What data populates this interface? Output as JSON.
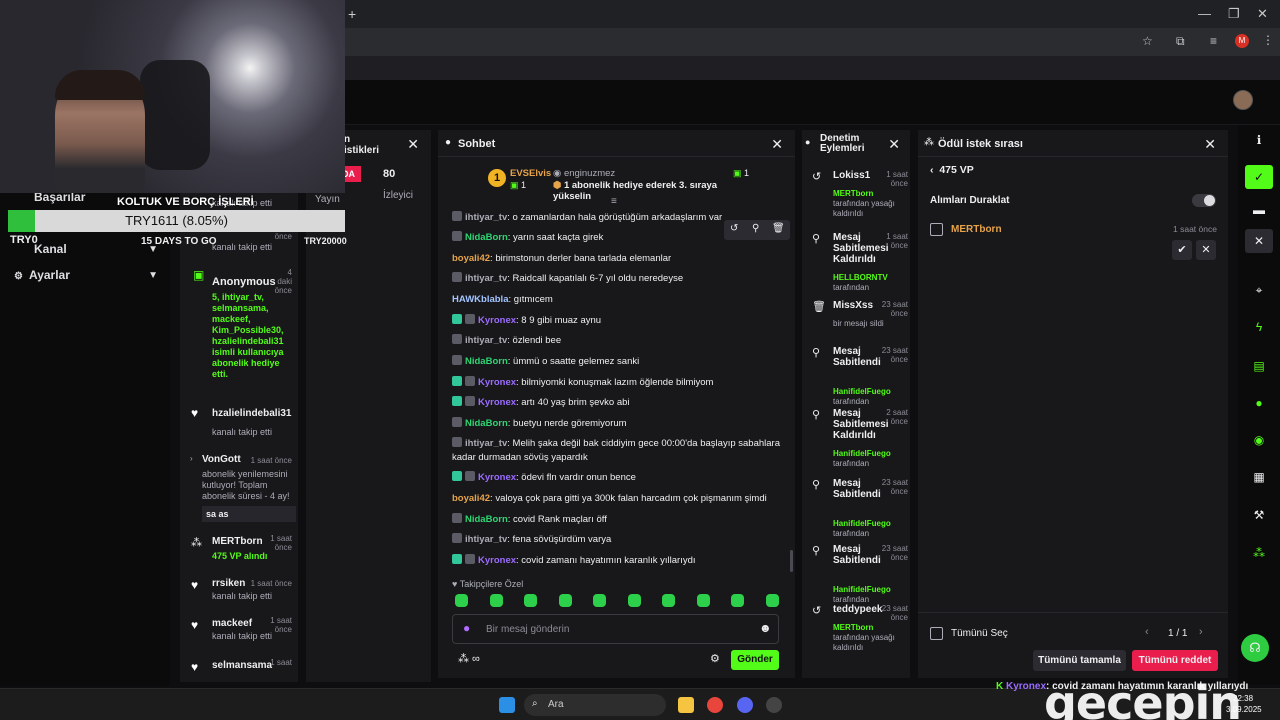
{
  "overlay": {
    "goal_title": "KOLTUK VE BORÇ İŞLERİ",
    "progress_text": "TRY1611 (8.05%)",
    "progress_fraction": 0.0805,
    "min_label": "TRY0",
    "days_left": "15 DAYS TO GO"
  },
  "left_nav": {
    "items": [
      {
        "label": "Başarılar"
      },
      {
        "label": "Kanal"
      },
      {
        "label": "Ayarlar"
      }
    ]
  },
  "activity_feed": [
    {
      "name": "",
      "sub": "kanalı takip etti",
      "time": ""
    },
    {
      "name": "",
      "sub": "kanalı takip etti",
      "time": "önce"
    },
    {
      "name": "Anonymous",
      "sub": "5, ihtiyar_tv, selmansama, mackeef, Kim_Possible30, hzalielindebali31 isimli kullanıcıya abonelik hediye etti.",
      "time": "4 daki önce"
    },
    {
      "name": "hzalielindebali31",
      "sub": "kanalı takip etti",
      "time": ""
    },
    {
      "name": "VonGott",
      "sub": "abonelik yenilemesini kutluyor! Toplam abonelik süresi - 4 ay!",
      "time": "1 saat önce",
      "message": "sa as"
    },
    {
      "name": "MERTborn",
      "sub": "475 VP alındı",
      "time": "1 saat önce"
    },
    {
      "name": "rrsiken",
      "sub": "kanalı takip etti",
      "time": "1 saat önce"
    },
    {
      "name": "mackeef",
      "sub": "kanalı takip etti",
      "time": "1 saat önce"
    },
    {
      "name": "selmansama",
      "sub": "",
      "time": "1 saat"
    }
  ],
  "stats": {
    "title_line1": "n",
    "title_line2": "istikleri",
    "tag": "DA",
    "viewers_value": "80",
    "viewers_label": "İzleyici",
    "stream_label": "Yayın",
    "goal_value": "TRY20000"
  },
  "chat": {
    "title": "Sohbet",
    "pinned": {
      "user": "EVSElvis",
      "level": "1",
      "gifter": "enginuzmez",
      "gifter_count": "1",
      "text": "1 abonelik hediye ederek 3. sıraya yükselin"
    },
    "messages": [
      {
        "user": "ihtiyar_tv",
        "color": "gray",
        "badges": [
          "mod"
        ],
        "text": "o zamanlardan hala görüştüğüm arkadaşlarım var"
      },
      {
        "user": "NidaBorn",
        "color": "green",
        "badges": [
          "mod"
        ],
        "text": "yarın saat kaçta girek"
      },
      {
        "user": "boyali42",
        "color": "orange",
        "badges": [],
        "text": "birimstonun derler bana tarlada elemanlar"
      },
      {
        "user": "ihtiyar_tv",
        "color": "gray",
        "badges": [
          "mod"
        ],
        "text": "Raidcall kapatılalı 6-7 yıl oldu neredeyse"
      },
      {
        "user": "HAWKblabla",
        "color": "blue",
        "badges": [],
        "text": "gıtmıcem"
      },
      {
        "user": "Kyronex",
        "color": "purple",
        "badges": [
          "sub",
          "mod"
        ],
        "text": "8 9 gibi muaz aynu"
      },
      {
        "user": "ihtiyar_tv",
        "color": "gray",
        "badges": [
          "mod"
        ],
        "text": "özlendi bee"
      },
      {
        "user": "NidaBorn",
        "color": "green",
        "badges": [
          "mod"
        ],
        "text": "ümmü o saatte gelemez sanki"
      },
      {
        "user": "Kyronex",
        "color": "purple",
        "badges": [
          "sub",
          "mod"
        ],
        "text": "bilmiyomki konuşmak lazım öğlende bilmiyom"
      },
      {
        "user": "Kyronex",
        "color": "purple",
        "badges": [
          "sub",
          "mod"
        ],
        "text": "artı 40 yaş brim şevko abi"
      },
      {
        "user": "NidaBorn",
        "color": "green",
        "badges": [
          "mod"
        ],
        "text": "buetyu nerde göremiyorum"
      },
      {
        "user": "ihtiyar_tv",
        "color": "gray",
        "badges": [
          "mod"
        ],
        "text": "Melih şaka değil bak ciddiyim gece 00:00'da başlayıp sabahlara kadar durmadan sövüş yapardık"
      },
      {
        "user": "Kyronex",
        "color": "purple",
        "badges": [
          "sub",
          "mod"
        ],
        "text": "ödevi fln vardır onun bence"
      },
      {
        "user": "boyali42",
        "color": "orange",
        "badges": [],
        "text": "valoya çok para gitti ya 300k falan harcadım çok pişmanım şimdi"
      },
      {
        "user": "NidaBorn",
        "color": "green",
        "badges": [
          "mod"
        ],
        "text": "covid Rank maçları öff"
      },
      {
        "user": "ihtiyar_tv",
        "color": "gray",
        "badges": [
          "mod"
        ],
        "text": "fena sövüşürdüm varya"
      },
      {
        "user": "Kyronex",
        "color": "purple",
        "badges": [
          "sub",
          "mod"
        ],
        "text": "covid zamanı hayatımın karanlık yıllarıydı"
      }
    ],
    "followers_only": "Takipçilere Özel",
    "input_placeholder": "Bir mesaj gönderin",
    "send_label": "Gönder"
  },
  "moderation": {
    "title_line1": "Denetim",
    "title_line2": "Eylemleri",
    "items": [
      {
        "icon": "undo-icon",
        "title": "Lokiss1",
        "time": "1 saat önce",
        "actor": "MERTborn",
        "desc": "tarafından yasağı kaldırıldı"
      },
      {
        "icon": "unpin-icon",
        "title": "Mesaj Sabitlemesi Kaldırıldı",
        "time": "1 saat önce",
        "actor": "HELLBORNTV",
        "desc": "tarafından"
      },
      {
        "icon": "trash-icon",
        "title": "MissXss",
        "time": "23 saat önce",
        "actor": "",
        "desc": "bir mesajı sildi"
      },
      {
        "icon": "pin-icon",
        "title": "Mesaj Sabitlendi",
        "time": "23 saat önce",
        "actor": "HanifidelFuego",
        "desc": "tarafından"
      },
      {
        "icon": "unpin-icon",
        "title": "Mesaj Sabitlemesi Kaldırıldı",
        "time": "2 saat önce",
        "actor": "HanifidelFuego",
        "desc": "tarafından"
      },
      {
        "icon": "pin-icon",
        "title": "Mesaj Sabitlendi",
        "time": "23 saat önce",
        "actor": "HanifidelFuego",
        "desc": "tarafından"
      },
      {
        "icon": "pin-icon",
        "title": "Mesaj Sabitlendi",
        "time": "23 saat önce",
        "actor": "HanifidelFuego",
        "desc": "tarafından"
      },
      {
        "icon": "undo-icon",
        "title": "teddypeek",
        "time": "23 saat önce",
        "actor": "MERTborn",
        "desc": "tarafından yasağı kaldırıldı"
      }
    ]
  },
  "rewards": {
    "title": "Ödül istek sırası",
    "back_label": "475 VP",
    "pause_label": "Alımları Duraklat",
    "request_user": "MERTborn",
    "request_time": "1 saat önce",
    "select_all": "Tümünü Seç",
    "page": "1 / 1",
    "complete_all": "Tümünü tamamla",
    "reject_all": "Tümünü reddet"
  },
  "taskbar": {
    "search_placeholder": "Ara",
    "clock": "22:38",
    "date": "3.09.2025"
  },
  "ticker": {
    "user": "Kyronex",
    "text": "covid zamanı hayatımın karanlık yıllarıydı"
  },
  "watermark": "gecepin",
  "colors": {
    "accent": "#53fc18",
    "danger": "#e91e4d",
    "panel": "#18181b",
    "background": "#0e0e10"
  }
}
